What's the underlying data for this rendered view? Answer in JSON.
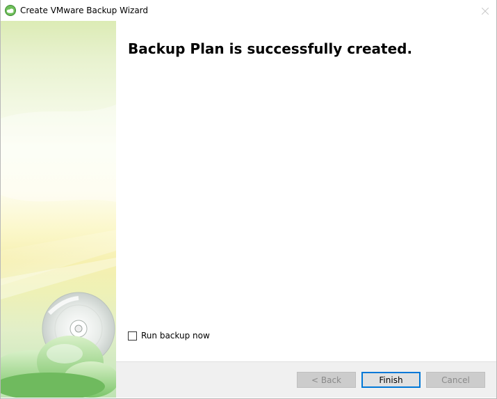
{
  "window": {
    "title": "Create VMware Backup Wizard",
    "icon": "cloud-backup-icon"
  },
  "main": {
    "heading": "Backup Plan is successfully created."
  },
  "run_backup": {
    "label": "Run backup now",
    "checked": false
  },
  "buttons": {
    "back": "< Back",
    "finish": "Finish",
    "cancel": "Cancel"
  },
  "colors": {
    "accent": "#0078d7",
    "sidebar_green": "#bfe3b3",
    "sidebar_yellow": "#f6f0b0"
  }
}
